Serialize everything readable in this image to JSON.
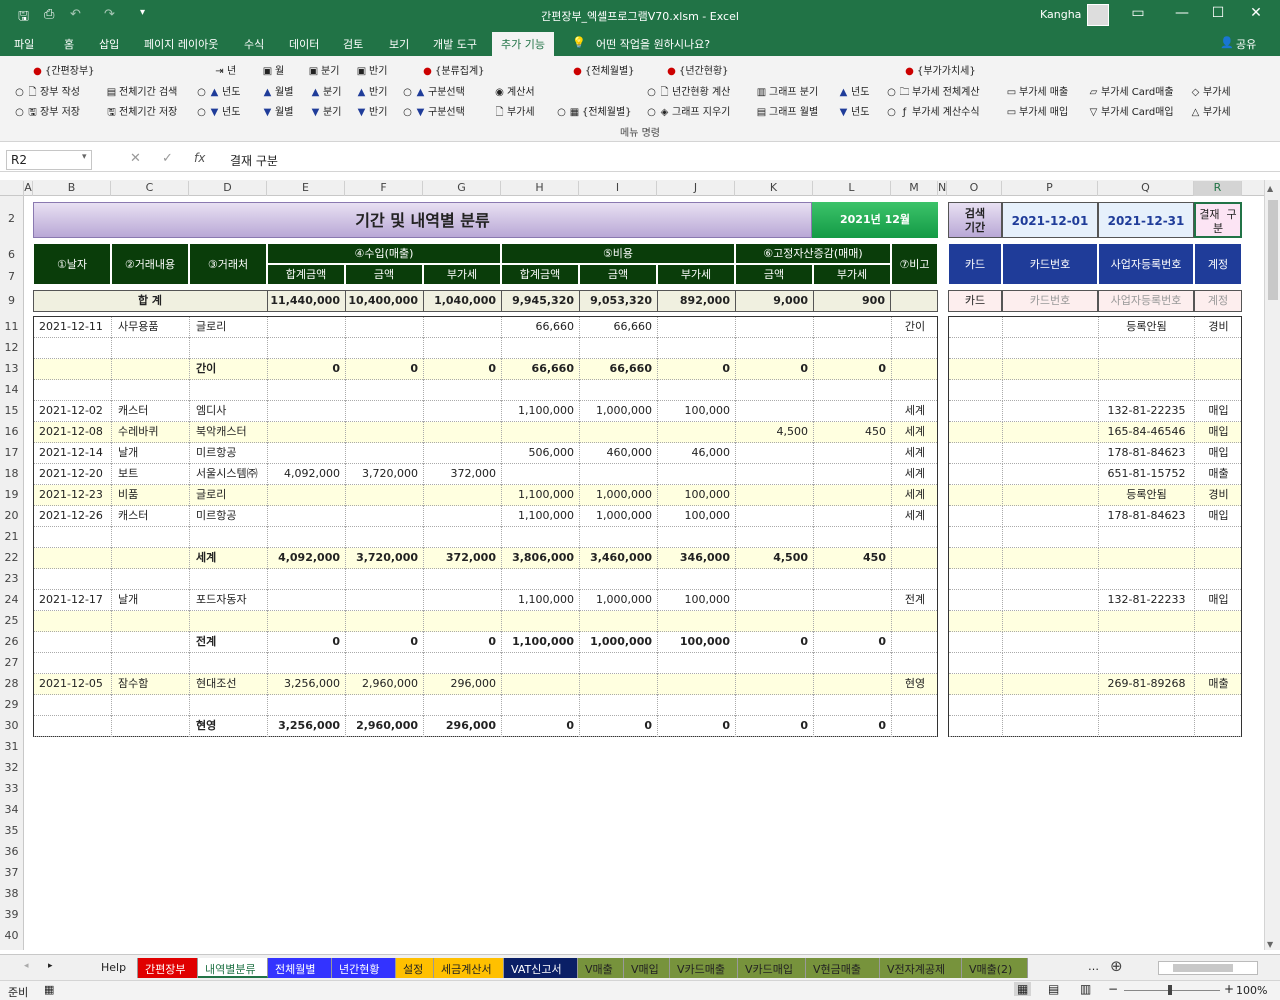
{
  "window": {
    "title": "간편장부_엑셀프로그램V70.xlsm  -  Excel",
    "user": "Kangha"
  },
  "tabs": [
    {
      "label": "파일"
    },
    {
      "label": "홈"
    },
    {
      "label": "삽입"
    },
    {
      "label": "페이지 레이아웃"
    },
    {
      "label": "수식"
    },
    {
      "label": "데이터"
    },
    {
      "label": "검토"
    },
    {
      "label": "보기"
    },
    {
      "label": "개발 도구"
    },
    {
      "label": "추가 기능"
    }
  ],
  "tell_me": "어떤 작업을 원하시나요?",
  "share": "공유",
  "ribbon": {
    "row1": [
      "{간편장부}",
      "년",
      "월",
      "분기",
      "반기",
      "{분류집계}",
      "{전체월별}",
      "{년간현황}",
      "{부가가치세}"
    ],
    "row2": [
      "장부 작성",
      "전체기간 검색",
      "년도",
      "월별",
      "분기",
      "반기",
      "구분선택",
      "계산서",
      "년간현황 계산",
      "그래프 분기",
      "년도",
      "부가세 전체계산",
      "부가세 매출",
      "부가세 Card매출",
      "부가세"
    ],
    "row3": [
      "장부 저장",
      "전체기간 저장",
      "년도",
      "월별",
      "분기",
      "반기",
      "구분선택",
      "부가세",
      "{전체월별}",
      "그래프 지우기",
      "그래프 월별",
      "년도",
      "부가세 계산수식",
      "부가세 매입",
      "부가세 Card매입",
      "부가세"
    ],
    "group_label": "메뉴 명령"
  },
  "formula_bar": {
    "name_box": "R2",
    "formula": "결재  구분"
  },
  "columns": [
    "A",
    "B",
    "C",
    "D",
    "E",
    "F",
    "G",
    "H",
    "I",
    "J",
    "K",
    "L",
    "M",
    "N",
    "O",
    "P",
    "Q",
    "R"
  ],
  "rows": [
    "2",
    "6",
    "7",
    "9",
    "11",
    "12",
    "13",
    "14",
    "15",
    "16",
    "17",
    "18",
    "19",
    "20",
    "21",
    "22",
    "23",
    "24",
    "25",
    "26",
    "27",
    "28",
    "29",
    "30",
    "31",
    "32",
    "33",
    "34",
    "35",
    "36",
    "37",
    "38",
    "39",
    "40"
  ],
  "sheet": {
    "title": "기간 및 내역별 분류",
    "month_badge": "2021년 12월",
    "search_label": "검색\n기간",
    "search_from": "2021-12-01",
    "search_to": "2021-12-31",
    "approval_label": "결재  구\n분",
    "headers": {
      "date": "①날자",
      "desc": "②거래내용",
      "vendor": "③거래처",
      "income": "④수입(매출)",
      "expense": "⑤비용",
      "asset": "⑥고정자산증감(매매)",
      "note": "⑦비고",
      "total_amt": "합계금액",
      "amt": "금액",
      "vat": "부가세",
      "card": "카드",
      "card_no": "카드번호",
      "biz_no": "사업자등록번호",
      "account": "계정"
    },
    "totals": {
      "label": "합        계",
      "e": "11,440,000",
      "f": "10,400,000",
      "g": "1,040,000",
      "h": "9,945,320",
      "i": "9,053,320",
      "j": "892,000",
      "k": "9,000",
      "l": "900",
      "card": "카드",
      "card_no": "카드번호",
      "biz_no": "사업자등록번호",
      "account": "계정"
    },
    "data_rows": [
      {
        "r": "11",
        "b": "2021-12-11",
        "c": "사무용품",
        "d": "글로리",
        "e": "",
        "f": "",
        "g": "",
        "h": "66,660",
        "i": "66,660",
        "j": "",
        "k": "",
        "l": "",
        "m": "간이",
        "q": "등록안됨",
        "r2": "경비",
        "y": false,
        "sub": false
      },
      {
        "r": "12",
        "b": "",
        "c": "",
        "d": "",
        "e": "",
        "f": "",
        "g": "",
        "h": "",
        "i": "",
        "j": "",
        "k": "",
        "l": "",
        "m": "",
        "q": "",
        "r2": "",
        "y": false,
        "sub": false
      },
      {
        "r": "13",
        "b": "",
        "c": "",
        "d": "간이",
        "e": "0",
        "f": "0",
        "g": "0",
        "h": "66,660",
        "i": "66,660",
        "j": "0",
        "k": "0",
        "l": "0",
        "m": "",
        "q": "",
        "r2": "",
        "y": true,
        "sub": true
      },
      {
        "r": "14",
        "b": "",
        "c": "",
        "d": "",
        "e": "",
        "f": "",
        "g": "",
        "h": "",
        "i": "",
        "j": "",
        "k": "",
        "l": "",
        "m": "",
        "q": "",
        "r2": "",
        "y": false,
        "sub": false
      },
      {
        "r": "15",
        "b": "2021-12-02",
        "c": "캐스터",
        "d": "엠디사",
        "e": "",
        "f": "",
        "g": "",
        "h": "1,100,000",
        "i": "1,000,000",
        "j": "100,000",
        "k": "",
        "l": "",
        "m": "세계",
        "q": "132-81-22235",
        "r2": "매입",
        "y": false,
        "sub": false
      },
      {
        "r": "16",
        "b": "2021-12-08",
        "c": "수레바퀴",
        "d": "북악캐스터",
        "e": "",
        "f": "",
        "g": "",
        "h": "",
        "i": "",
        "j": "",
        "k": "4,500",
        "l": "450",
        "m": "세계",
        "q": "165-84-46546",
        "r2": "매입",
        "y": true,
        "sub": false
      },
      {
        "r": "17",
        "b": "2021-12-14",
        "c": "날개",
        "d": "미르항공",
        "e": "",
        "f": "",
        "g": "",
        "h": "506,000",
        "i": "460,000",
        "j": "46,000",
        "k": "",
        "l": "",
        "m": "세계",
        "q": "178-81-84623",
        "r2": "매입",
        "y": false,
        "sub": false
      },
      {
        "r": "18",
        "b": "2021-12-20",
        "c": "보트",
        "d": "서울시스템㈜",
        "e": "4,092,000",
        "f": "3,720,000",
        "g": "372,000",
        "h": "",
        "i": "",
        "j": "",
        "k": "",
        "l": "",
        "m": "세계",
        "q": "651-81-15752",
        "r2": "매출",
        "y": false,
        "sub": false
      },
      {
        "r": "19",
        "b": "2021-12-23",
        "c": "비품",
        "d": "글로리",
        "e": "",
        "f": "",
        "g": "",
        "h": "1,100,000",
        "i": "1,000,000",
        "j": "100,000",
        "k": "",
        "l": "",
        "m": "세계",
        "q": "등록안됨",
        "r2": "경비",
        "y": true,
        "sub": false
      },
      {
        "r": "20",
        "b": "2021-12-26",
        "c": "캐스터",
        "d": "미르항공",
        "e": "",
        "f": "",
        "g": "",
        "h": "1,100,000",
        "i": "1,000,000",
        "j": "100,000",
        "k": "",
        "l": "",
        "m": "세계",
        "q": "178-81-84623",
        "r2": "매입",
        "y": false,
        "sub": false
      },
      {
        "r": "21",
        "b": "",
        "c": "",
        "d": "",
        "e": "",
        "f": "",
        "g": "",
        "h": "",
        "i": "",
        "j": "",
        "k": "",
        "l": "",
        "m": "",
        "q": "",
        "r2": "",
        "y": false,
        "sub": false
      },
      {
        "r": "22",
        "b": "",
        "c": "",
        "d": "세계",
        "e": "4,092,000",
        "f": "3,720,000",
        "g": "372,000",
        "h": "3,806,000",
        "i": "3,460,000",
        "j": "346,000",
        "k": "4,500",
        "l": "450",
        "m": "",
        "q": "",
        "r2": "",
        "y": true,
        "sub": true
      },
      {
        "r": "23",
        "b": "",
        "c": "",
        "d": "",
        "e": "",
        "f": "",
        "g": "",
        "h": "",
        "i": "",
        "j": "",
        "k": "",
        "l": "",
        "m": "",
        "q": "",
        "r2": "",
        "y": false,
        "sub": false
      },
      {
        "r": "24",
        "b": "2021-12-17",
        "c": "날개",
        "d": "포드자동자",
        "e": "",
        "f": "",
        "g": "",
        "h": "1,100,000",
        "i": "1,000,000",
        "j": "100,000",
        "k": "",
        "l": "",
        "m": "전계",
        "q": "132-81-22233",
        "r2": "매입",
        "y": false,
        "sub": false
      },
      {
        "r": "25",
        "b": "",
        "c": "",
        "d": "",
        "e": "",
        "f": "",
        "g": "",
        "h": "",
        "i": "",
        "j": "",
        "k": "",
        "l": "",
        "m": "",
        "q": "",
        "r2": "",
        "y": true,
        "sub": false
      },
      {
        "r": "26",
        "b": "",
        "c": "",
        "d": "전계",
        "e": "0",
        "f": "0",
        "g": "0",
        "h": "1,100,000",
        "i": "1,000,000",
        "j": "100,000",
        "k": "0",
        "l": "0",
        "m": "",
        "q": "",
        "r2": "",
        "y": false,
        "sub": true
      },
      {
        "r": "27",
        "b": "",
        "c": "",
        "d": "",
        "e": "",
        "f": "",
        "g": "",
        "h": "",
        "i": "",
        "j": "",
        "k": "",
        "l": "",
        "m": "",
        "q": "",
        "r2": "",
        "y": false,
        "sub": false
      },
      {
        "r": "28",
        "b": "2021-12-05",
        "c": "잠수함",
        "d": "현대조선",
        "e": "3,256,000",
        "f": "2,960,000",
        "g": "296,000",
        "h": "",
        "i": "",
        "j": "",
        "k": "",
        "l": "",
        "m": "현영",
        "q": "269-81-89268",
        "r2": "매출",
        "y": true,
        "sub": false
      },
      {
        "r": "29",
        "b": "",
        "c": "",
        "d": "",
        "e": "",
        "f": "",
        "g": "",
        "h": "",
        "i": "",
        "j": "",
        "k": "",
        "l": "",
        "m": "",
        "q": "",
        "r2": "",
        "y": false,
        "sub": false
      },
      {
        "r": "30",
        "b": "",
        "c": "",
        "d": "현영",
        "e": "3,256,000",
        "f": "2,960,000",
        "g": "296,000",
        "h": "0",
        "i": "0",
        "j": "0",
        "k": "0",
        "l": "0",
        "m": "",
        "q": "",
        "r2": "",
        "y": false,
        "sub": true
      }
    ]
  },
  "sheet_tabs": [
    {
      "label": "Help",
      "bg": "#f0f0f0",
      "fg": "#222"
    },
    {
      "label": "간편장부",
      "bg": "#e00000",
      "fg": "#fff"
    },
    {
      "label": "내역별분류",
      "bg": "#ffffff",
      "fg": "#217346"
    },
    {
      "label": "전체월별",
      "bg": "#3333ff",
      "fg": "#fff"
    },
    {
      "label": "년간현황",
      "bg": "#3333ff",
      "fg": "#fff"
    },
    {
      "label": "설정",
      "bg": "#ffc000",
      "fg": "#222"
    },
    {
      "label": "세금계산서",
      "bg": "#ffc000",
      "fg": "#222"
    },
    {
      "label": "VAT신고서",
      "bg": "#0a1f66",
      "fg": "#fff"
    },
    {
      "label": "V매출",
      "bg": "#77933c",
      "fg": "#222"
    },
    {
      "label": "V매입",
      "bg": "#77933c",
      "fg": "#222"
    },
    {
      "label": "V카드매출",
      "bg": "#77933c",
      "fg": "#222"
    },
    {
      "label": "V카드매입",
      "bg": "#77933c",
      "fg": "#222"
    },
    {
      "label": "V현금매출",
      "bg": "#77933c",
      "fg": "#222"
    },
    {
      "label": "V전자계공제",
      "bg": "#77933c",
      "fg": "#222"
    },
    {
      "label": "V매출(2)",
      "bg": "#77933c",
      "fg": "#222"
    }
  ],
  "status": {
    "ready": "준비",
    "zoom": "100%"
  },
  "colors": {
    "excel_green": "#217346",
    "header_green": "#0a3d0a",
    "header_blue": "#1f3c99"
  }
}
